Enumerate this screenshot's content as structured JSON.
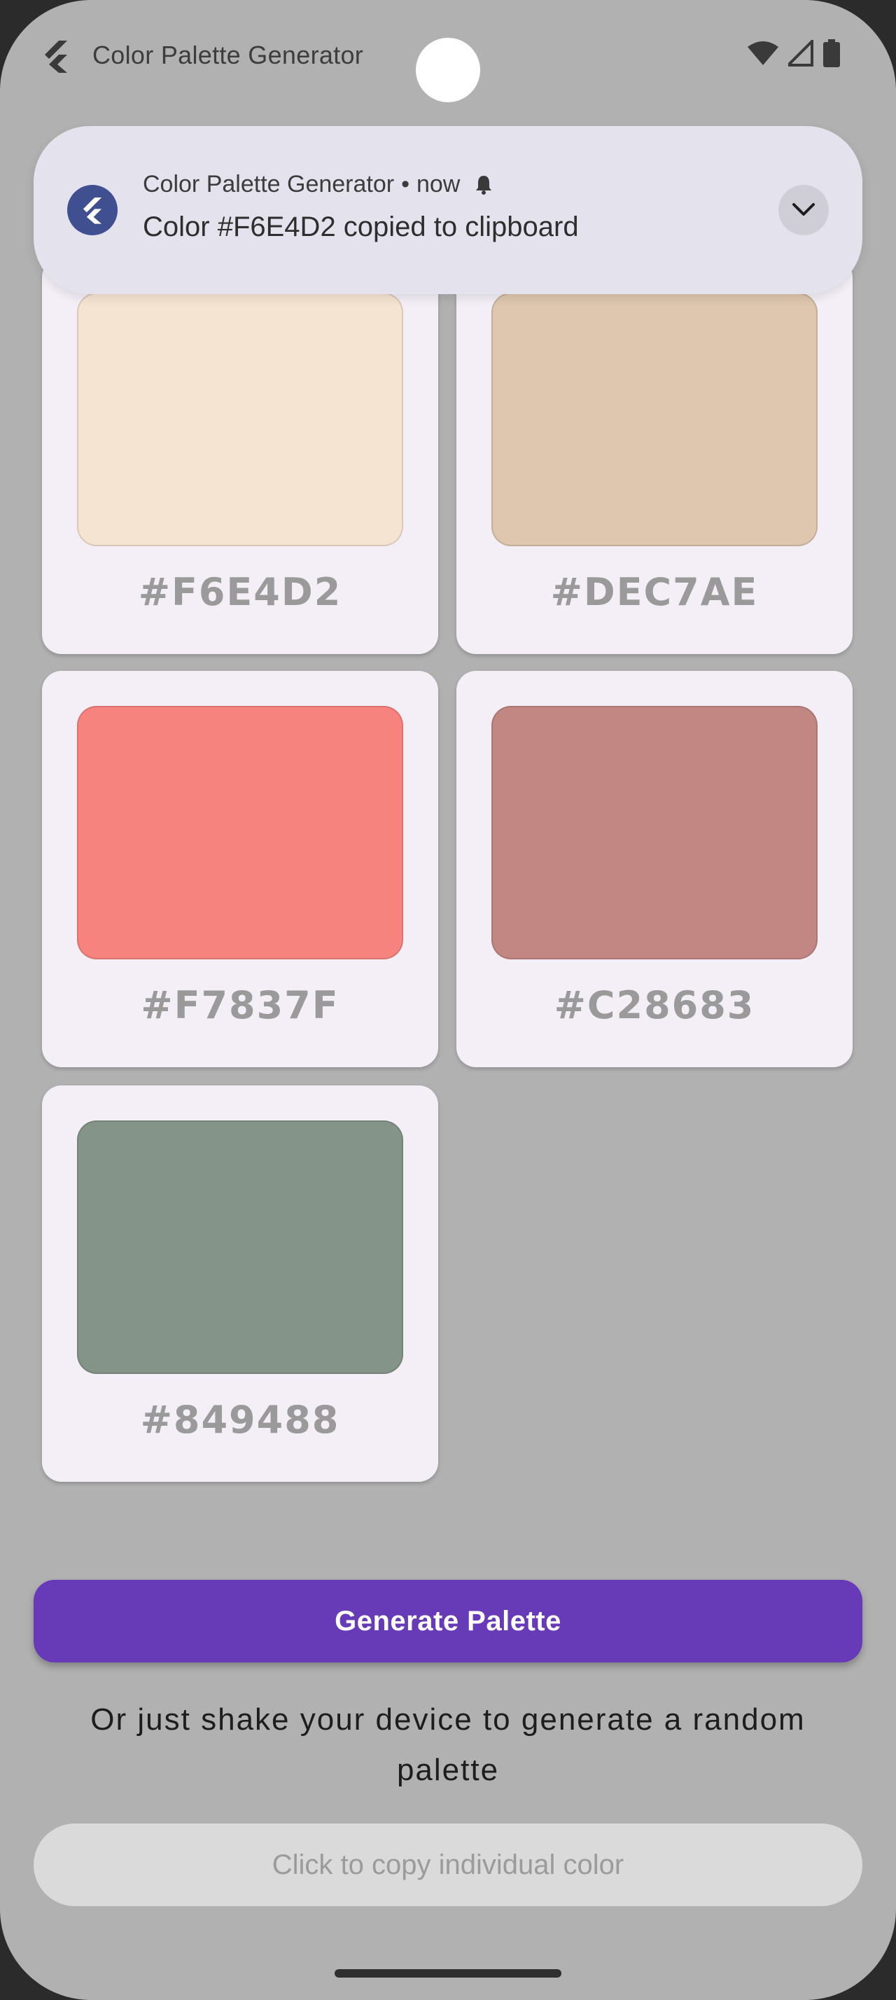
{
  "status_bar": {
    "app_name": "Color Palette Generator",
    "icons": [
      "wifi-icon",
      "signal-icon",
      "battery-icon"
    ]
  },
  "notification": {
    "app_name": "Color Palette Generator",
    "separator": "•",
    "time": "now",
    "message": "Color #F6E4D2 copied to clipboard",
    "icon": "flutter-logo-icon",
    "expand_icon": "chevron-down-icon"
  },
  "palette": {
    "colors": [
      {
        "hex": "#F6E4D2",
        "value": "#F6E4D2"
      },
      {
        "hex": "#DEC7AE",
        "value": "#DEC7AE"
      },
      {
        "hex": "#F7837F",
        "value": "#F7837F"
      },
      {
        "hex": "#C28683",
        "value": "#C28683"
      },
      {
        "hex": "#849488",
        "value": "#849488"
      }
    ]
  },
  "actions": {
    "generate_label": "Generate Palette",
    "shake_hint": "Or just shake your device to generate a random palette",
    "copy_hint_label": "Click to copy individual color"
  },
  "theme": {
    "accent": "#673AB7",
    "card_bg": "#F4EFF7",
    "scrim": "#B1B1B1"
  }
}
